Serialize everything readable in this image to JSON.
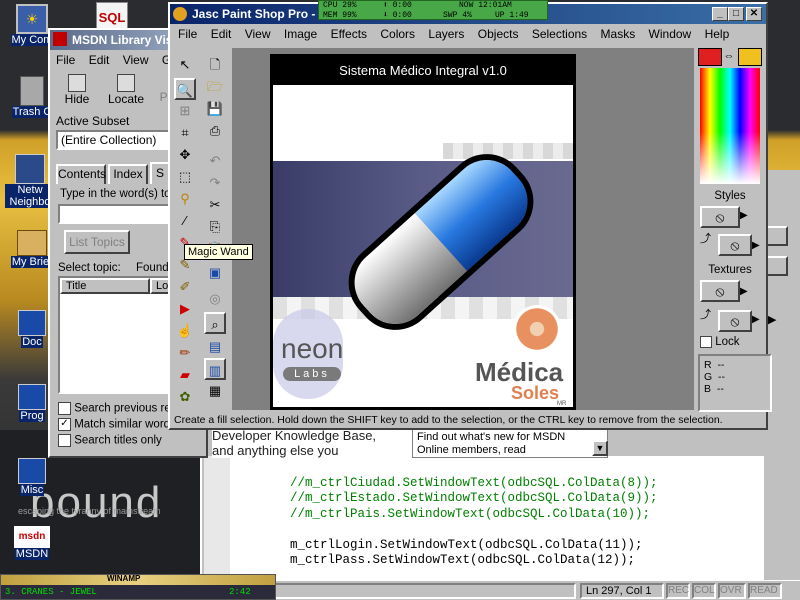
{
  "colors": {
    "accent_red": "#e02020",
    "accent_yellow": "#f0c020",
    "title_active": "#0a246a",
    "code_green": "#008000"
  },
  "desktop": {
    "icons": [
      {
        "label": "My Com",
        "icon": "computer-icon"
      },
      {
        "label": "Trash C",
        "icon": "trash-icon"
      },
      {
        "label": "Netw Neighbo",
        "icon": "network-icon"
      },
      {
        "label": "My Brief",
        "icon": "briefcase-icon"
      },
      {
        "label": "Doc",
        "icon": "document-icon"
      },
      {
        "label": "Prog",
        "icon": "program-icon"
      },
      {
        "label": "Misc",
        "icon": "folder-icon"
      },
      {
        "label": "MSDN",
        "icon": "msdn-icon"
      }
    ],
    "wallpaper_text": "bound",
    "wallpaper_subtext": "escaping the tyranny of mainstream",
    "sql_logo": "SQL"
  },
  "sysmon": {
    "cpu": "CPU 29%",
    "mem": "MEM 99%",
    "up1": "⬆ 0:00",
    "dn1": "⬇ 0:00",
    "now": "NOW 12:01AM",
    "up": "UP 1:49",
    "swp": "SWP 4%"
  },
  "psp": {
    "title": "Jasc Paint Shop Pro - ",
    "menu": [
      "File",
      "Edit",
      "View",
      "Image",
      "Effects",
      "Colors",
      "Layers",
      "Objects",
      "Selections",
      "Masks",
      "Window",
      "Help"
    ],
    "tooltip": "Magic Wand",
    "status": "Create a fill selection. Hold down the SHIFT key to add to the selection, or the CTRL key to remove from the selection.",
    "palette": {
      "styles": "Styles",
      "textures": "Textures",
      "lock": "Lock",
      "r": "R",
      "g": "G",
      "b": "B",
      "dash": "--"
    },
    "canvas": {
      "header": "Sistema  Médico  Integral  v1.0",
      "neon": "neon",
      "labs": "Labs",
      "medica": "Médica",
      "soles": "Soles",
      "mr": "MR"
    }
  },
  "msdn": {
    "title": "MSDN Library Vis",
    "menu": [
      "File",
      "Edit",
      "View",
      "Go"
    ],
    "toolbar": [
      "Hide",
      "Locate",
      "Pre"
    ],
    "active_subset_label": "Active Subset",
    "subset_value": "(Entire Collection)",
    "tabs": [
      "Contents",
      "Index",
      "S"
    ],
    "type_label": "Type in the word(s) to s",
    "list_topics": "List Topics",
    "select_topic": "Select topic:",
    "found": "Found:",
    "col_title": "Title",
    "col_lo": "Lo",
    "search_previous": "Search previous re",
    "match_similar": "Match similar words",
    "search_titles": "Search titles only"
  },
  "code": {
    "lines": [
      "//m_ctrlCiudad.SetWindowText(odbcSQL.ColData(8));",
      "//m_ctrlEstado.SetWindowText(odbcSQL.ColData(9));",
      "//m_ctrlPais.SetWindowText(odbcSQL.ColData(10));",
      "",
      "m_ctrlLogin.SetWindowText(odbcSQL.ColData(11));",
      "m_ctrlPass.SetWindowText(odbcSQL.ColData(12));"
    ],
    "msdn_line1": "Developer Knowledge Base,",
    "msdn_line2": "and anything else you",
    "whatsnew1": "Find out what's new for MSDN",
    "whatsnew2": "Online members, read"
  },
  "vs_status": {
    "pos": "Ln 297, Col 1",
    "rec": "REC",
    "col": "COL",
    "ovr": "OVR",
    "read": "READ"
  },
  "winamp": {
    "title": "WINAMP",
    "track": "3. CRANES - JEWEL",
    "time": "2:42"
  }
}
